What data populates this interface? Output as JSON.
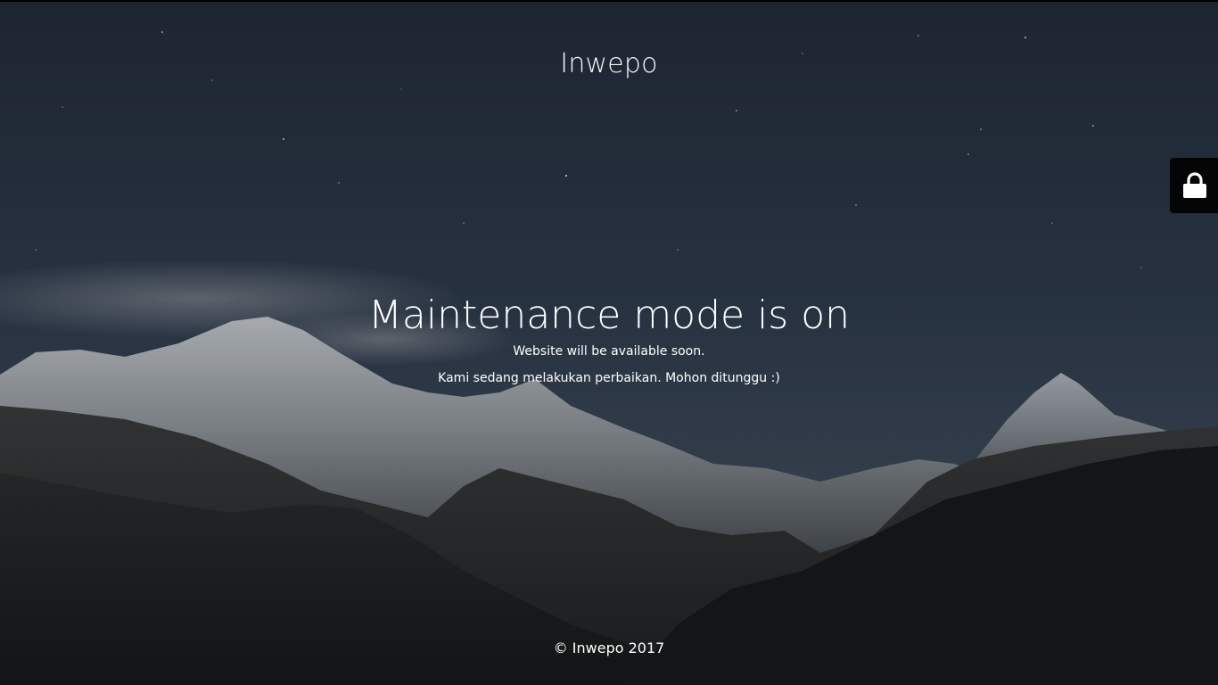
{
  "site": {
    "title": "Inwepo"
  },
  "main": {
    "headline": "Maintenance mode is on",
    "message_line1": "Website will be available soon.",
    "message_line2": "Kami sedang melakukan perbaikan. Mohon ditunggu :)"
  },
  "footer": {
    "copyright": "© Inwepo 2017"
  },
  "login": {
    "icon": "lock-icon"
  },
  "colors": {
    "sky_top": "#242d3c",
    "sky_mid": "#34404f",
    "login_tab": "#050505",
    "text": "#ffffff"
  }
}
